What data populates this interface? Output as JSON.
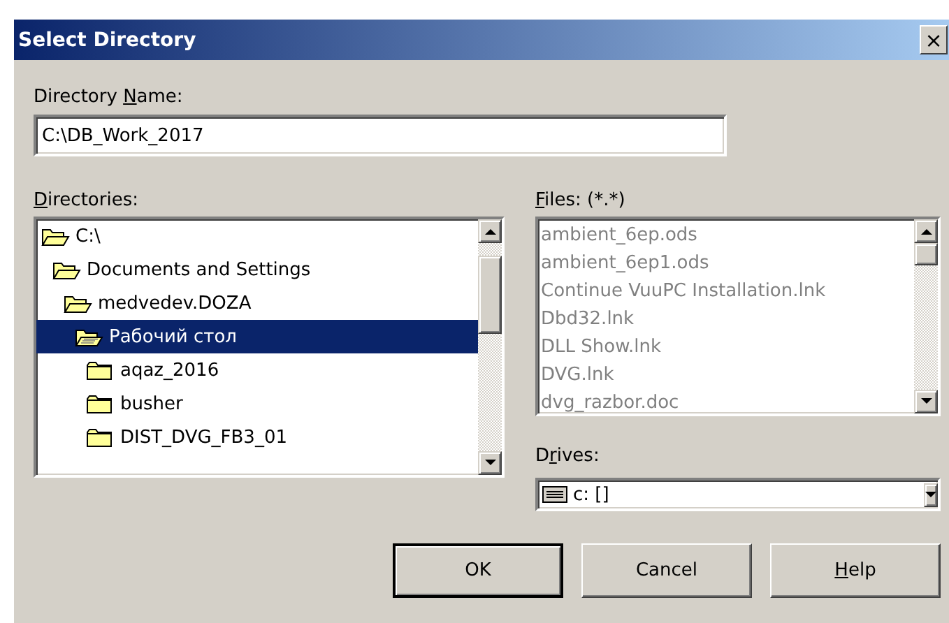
{
  "window": {
    "title": "Select Directory",
    "close": "×"
  },
  "directory_name": {
    "label": {
      "pre": "Directory ",
      "key": "N",
      "post": "ame:"
    },
    "value": "C:\\DB_Work_2017"
  },
  "directories": {
    "label": {
      "key": "D",
      "post": "irectories:"
    },
    "items": [
      {
        "name": "C:\\",
        "selected": false,
        "children": [
          {
            "name": "Documents and Settings",
            "selected": false,
            "children": [
              {
                "name": "medvedev.DOZA",
                "selected": false,
                "children": [
                  {
                    "name": "Рабочий стол",
                    "selected": true,
                    "children": [
                      {
                        "name": "aqaz_2016",
                        "selected": false
                      },
                      {
                        "name": "busher",
                        "selected": false
                      },
                      {
                        "name": "DIST_DVG_FB3_01",
                        "selected": false
                      }
                    ]
                  }
                ]
              }
            ]
          }
        ]
      }
    ]
  },
  "files": {
    "label": {
      "key": "F",
      "post": "iles: (*.*)"
    },
    "disabled": true,
    "items": [
      "ambient_6ep.ods",
      "ambient_6ep1.ods",
      "Continue VuuPC Installation.lnk",
      "Dbd32.lnk",
      "DLL Show.lnk",
      "DVG.lnk",
      "dvg_razbor.doc"
    ]
  },
  "drives": {
    "label": {
      "pre": "D",
      "key": "r",
      "post": "ives:"
    },
    "value": "c: []"
  },
  "buttons": [
    {
      "label": {
        "pre": "OK"
      },
      "default": true
    },
    {
      "label": {
        "pre": "Cancel"
      },
      "default": false
    },
    {
      "label": {
        "key": "H",
        "post": "elp"
      },
      "default": false
    }
  ]
}
